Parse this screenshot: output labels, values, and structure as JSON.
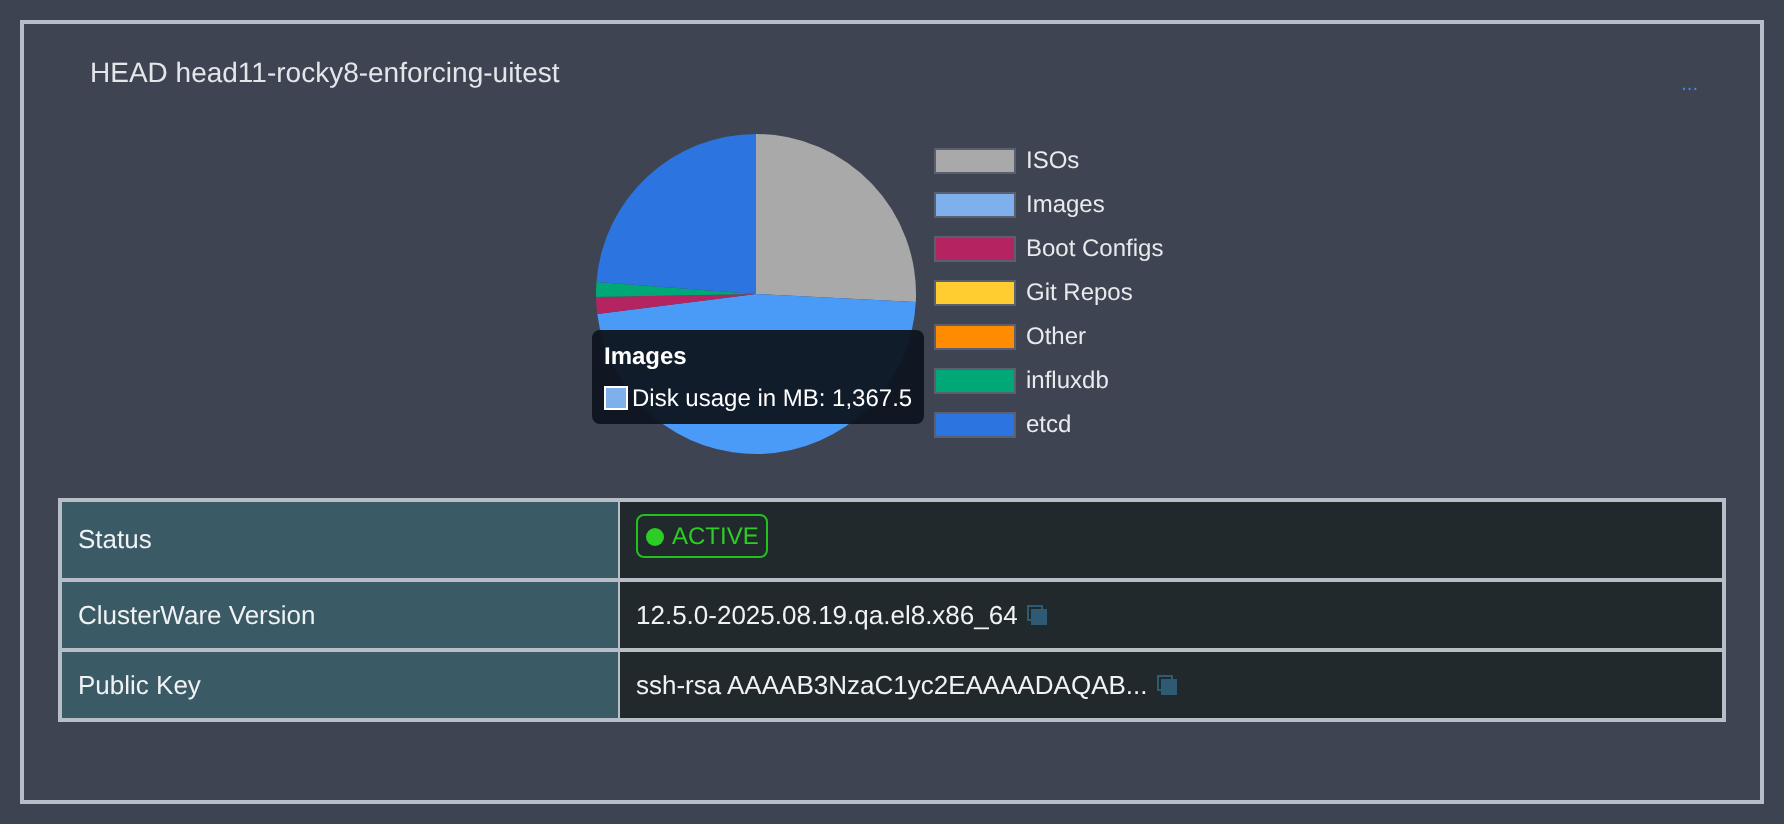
{
  "panel": {
    "title": "HEAD head11-rocky8-enforcing-uitest",
    "menu": "..."
  },
  "legend": [
    {
      "label": "ISOs",
      "color": "#a9a9a9"
    },
    {
      "label": "Images",
      "color": "#7eb1ec"
    },
    {
      "label": "Boot Configs",
      "color": "#b32460"
    },
    {
      "label": "Git Repos",
      "color": "#ffcd2f"
    },
    {
      "label": "Other",
      "color": "#ff8c00"
    },
    {
      "label": "influxdb",
      "color": "#00a878"
    },
    {
      "label": "etcd",
      "color": "#2c74e0"
    }
  ],
  "tooltip": {
    "title": "Images",
    "label": "Disk usage in MB: 1,367.5",
    "color": "#7eb1ec"
  },
  "table": {
    "rows": [
      {
        "kind": "status",
        "label": "Status",
        "value": "ACTIVE"
      },
      {
        "kind": "copy",
        "label": "ClusterWare Version",
        "value": "12.5.0-2025.08.19.qa.el8.x86_64"
      },
      {
        "kind": "copy",
        "label": "Public Key",
        "value": "ssh-rsa AAAAB3NzaC1yc2EAAAADAQAB..."
      }
    ]
  }
}
